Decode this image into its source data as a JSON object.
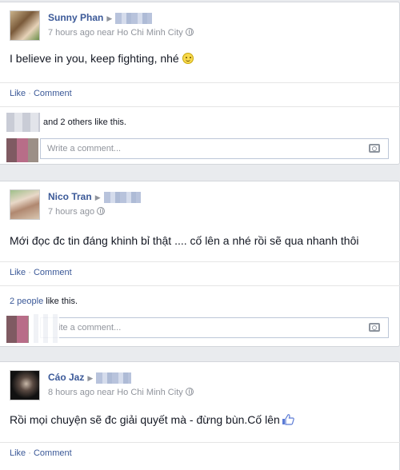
{
  "posts": [
    {
      "author": "Sunny Phan",
      "meta": "7 hours ago near Ho Chi Minh City",
      "text": "I believe in you, keep fighting, nhé",
      "actions": {
        "like": "Like",
        "sep": " · ",
        "comment": "Comment"
      },
      "likes": "and 2 others like this.",
      "comment_placeholder": "Write a comment..."
    },
    {
      "author": "Nico Tran",
      "meta": "7 hours ago",
      "text": "Mới đọc đc tin đáng khinh bỉ thật .... cố lên a nhé rồi sẽ qua nhanh thôi",
      "actions": {
        "like": "Like",
        "sep": " · ",
        "comment": "Comment"
      },
      "likes_link": "2 people",
      "likes": " like this.",
      "comment_placeholder": "ite a comment..."
    },
    {
      "author": "Cáo Jaz",
      "meta": "8 hours ago near Ho Chi Minh City",
      "text": "Rồi mọi chuyện sẽ đc giải quyết mà - đừng bùn.Cố lên",
      "actions": {
        "like": "Like",
        "sep": " · ",
        "comment": "Comment"
      }
    }
  ],
  "icons": {
    "globe": "globe-icon",
    "camera": "camera-icon",
    "smiley": "smiley-icon",
    "thumbs_up": "thumbs-up-icon",
    "arrow": "▶"
  },
  "colors": {
    "link": "#3b5998",
    "meta": "#90949c",
    "background": "#e9ebee"
  }
}
